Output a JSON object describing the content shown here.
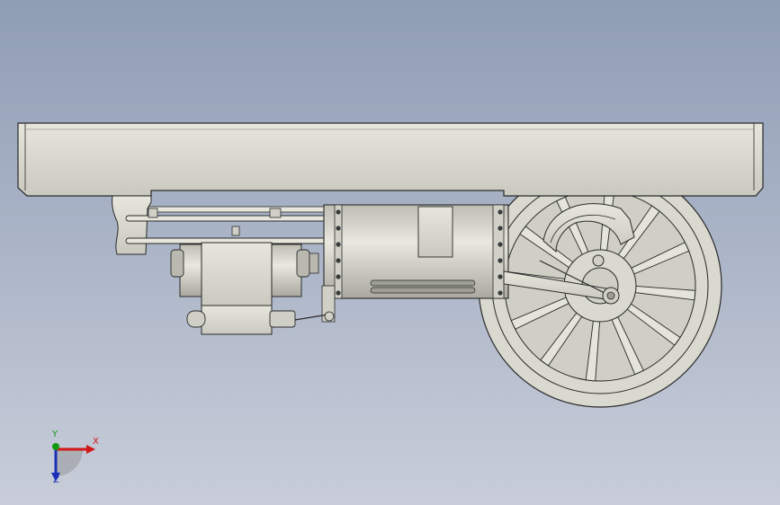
{
  "viewport": {
    "background_top": "#8f9db4",
    "background_bottom": "#c8cdd9",
    "part_color": "#dcdcd2",
    "edge_color": "#2a2a2a"
  },
  "triad": {
    "x_label": "X",
    "y_label": "Y",
    "z_label": "Z",
    "x_color": "#d01818",
    "y_color": "#139913",
    "z_color": "#1b2fb8"
  }
}
